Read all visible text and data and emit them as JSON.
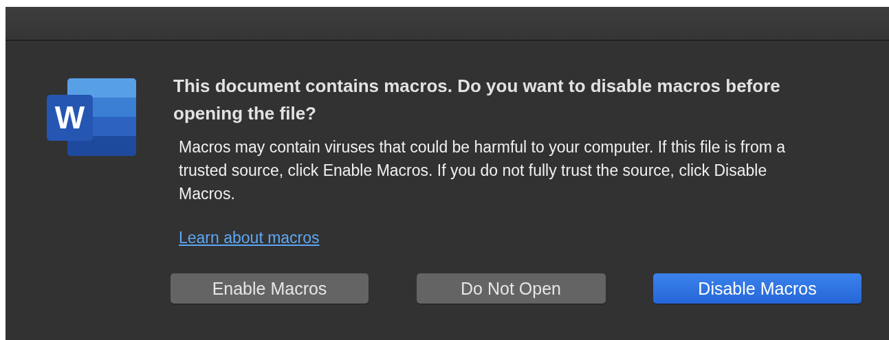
{
  "app_icon": {
    "letter": "W"
  },
  "heading": "This document contains macros. Do you want to disable macros before opening the file?",
  "message": "Macros may contain viruses that could be harmful to your computer.  If this file is from a trusted source, click Enable Macros. If you do not fully trust the source, click Disable Macros.",
  "link": "Learn about macros",
  "buttons": [
    {
      "label": "Enable Macros",
      "kind": "normal"
    },
    {
      "label": "Do Not Open",
      "kind": "normal"
    },
    {
      "label": "Disable Macros",
      "kind": "default"
    }
  ]
}
